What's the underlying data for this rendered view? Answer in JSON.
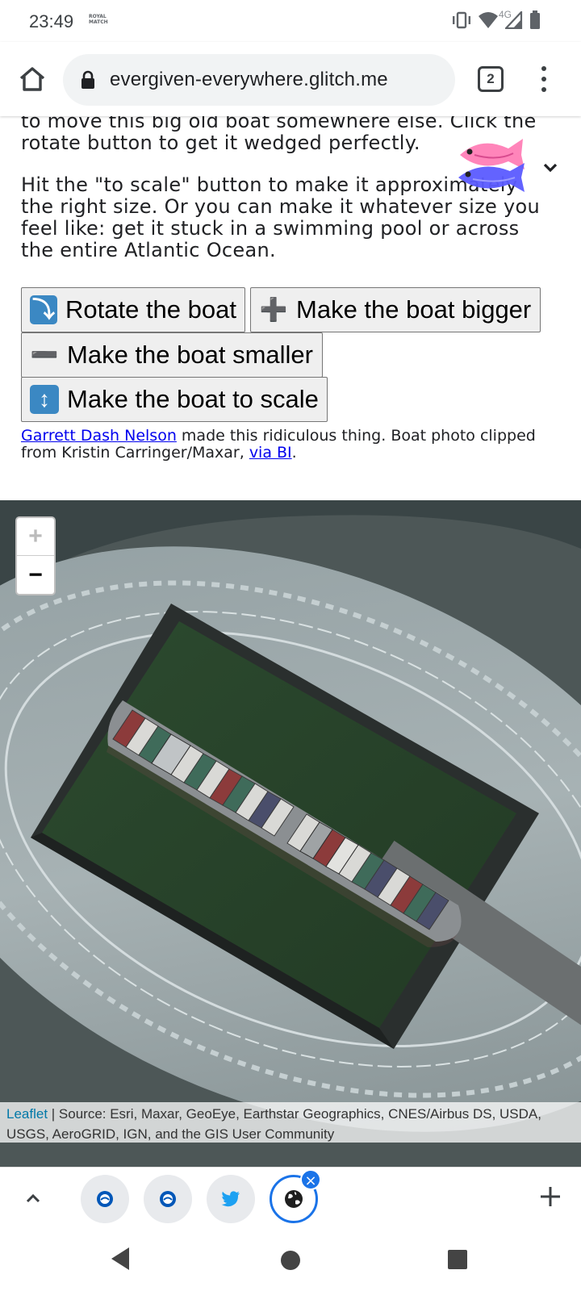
{
  "status_bar": {
    "time": "23:49",
    "carrier_logo_text": "ROYAL MATCH",
    "network": "4G",
    "icons": [
      "vibrate-icon",
      "wifi-icon",
      "signal-icon",
      "battery-icon"
    ]
  },
  "browser": {
    "url": "evergiven-everywhere.glitch.me",
    "tab_count": "2",
    "icons": [
      "home-icon",
      "lock-icon",
      "more-vert-icon"
    ]
  },
  "content": {
    "paragraph_1": "to move this big old boat somewhere else. Click the rotate button to get it wedged perfectly.",
    "paragraph_2": "Hit the \"to scale\" button to make it approximately the right size. Or you can make it whatever size you feel like: get it stuck in a swimming pool or across the entire Atlantic Ocean.",
    "buttons": {
      "rotate": {
        "icon": "⤵",
        "label": "Rotate the boat"
      },
      "bigger": {
        "icon": "➕",
        "label": "Make the boat bigger"
      },
      "smaller": {
        "icon": "➖",
        "label": "Make the boat smaller"
      },
      "scale": {
        "icon": "↕",
        "label": "Make the boat to scale"
      }
    },
    "credits": {
      "author_link": "Garrett Dash Nelson",
      "text_1": " made this ridiculous thing. Boat photo clipped from Kristin Carringer/Maxar, ",
      "source_link": "via BI",
      "text_2": "."
    }
  },
  "map": {
    "zoom_in": "+",
    "zoom_out": "−",
    "attribution_link": "Leaflet",
    "attribution_text": " | Source: Esri, Maxar, GeoEye, Earthstar Geographics, CNES/Airbus DS, USDA, USGS, AeroGRID, IGN, and the GIS User Community"
  },
  "tab_strip": {
    "tabs": [
      "brighton-favicon",
      "brighton-favicon",
      "twitter-favicon",
      "glitch-favicon"
    ],
    "active_tab_index": 3,
    "close_label": "×"
  },
  "colors": {
    "link": "#0000ee",
    "leaflet_link": "#0078a8",
    "accent": "#1a73e8",
    "button_bg": "#efefef",
    "emoji_blue": "#3b88c3"
  }
}
